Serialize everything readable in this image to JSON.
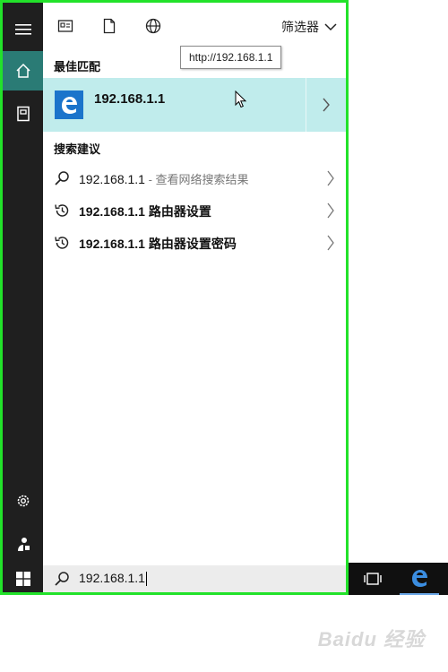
{
  "topbar": {
    "icons": [
      "news-icon",
      "document-icon",
      "globe-icon"
    ],
    "filter_label": "筛选器"
  },
  "tooltip": {
    "text": "http://192.168.1.1"
  },
  "best_match": {
    "heading": "最佳匹配",
    "title": "192.168.1.1",
    "icon": "edge-icon"
  },
  "suggestions": {
    "heading": "搜索建议",
    "items": [
      {
        "icon": "search-icon",
        "text": "192.168.1.1",
        "suffix": " - 查看网络搜索结果"
      },
      {
        "icon": "history-icon",
        "text": "192.168.1.1 路由器设置",
        "suffix": ""
      },
      {
        "icon": "history-icon",
        "text": "192.168.1.1 路由器设置密码",
        "suffix": ""
      }
    ]
  },
  "search": {
    "value": "192.168.1.1"
  },
  "colors": {
    "highlight": "#c0ecec",
    "rail": "#1f1f1f",
    "rail_active": "#2a7b75",
    "frame_border": "#22e22a",
    "edge_blue": "#1b74cb"
  },
  "watermark": {
    "text": "Baidu 经验"
  }
}
